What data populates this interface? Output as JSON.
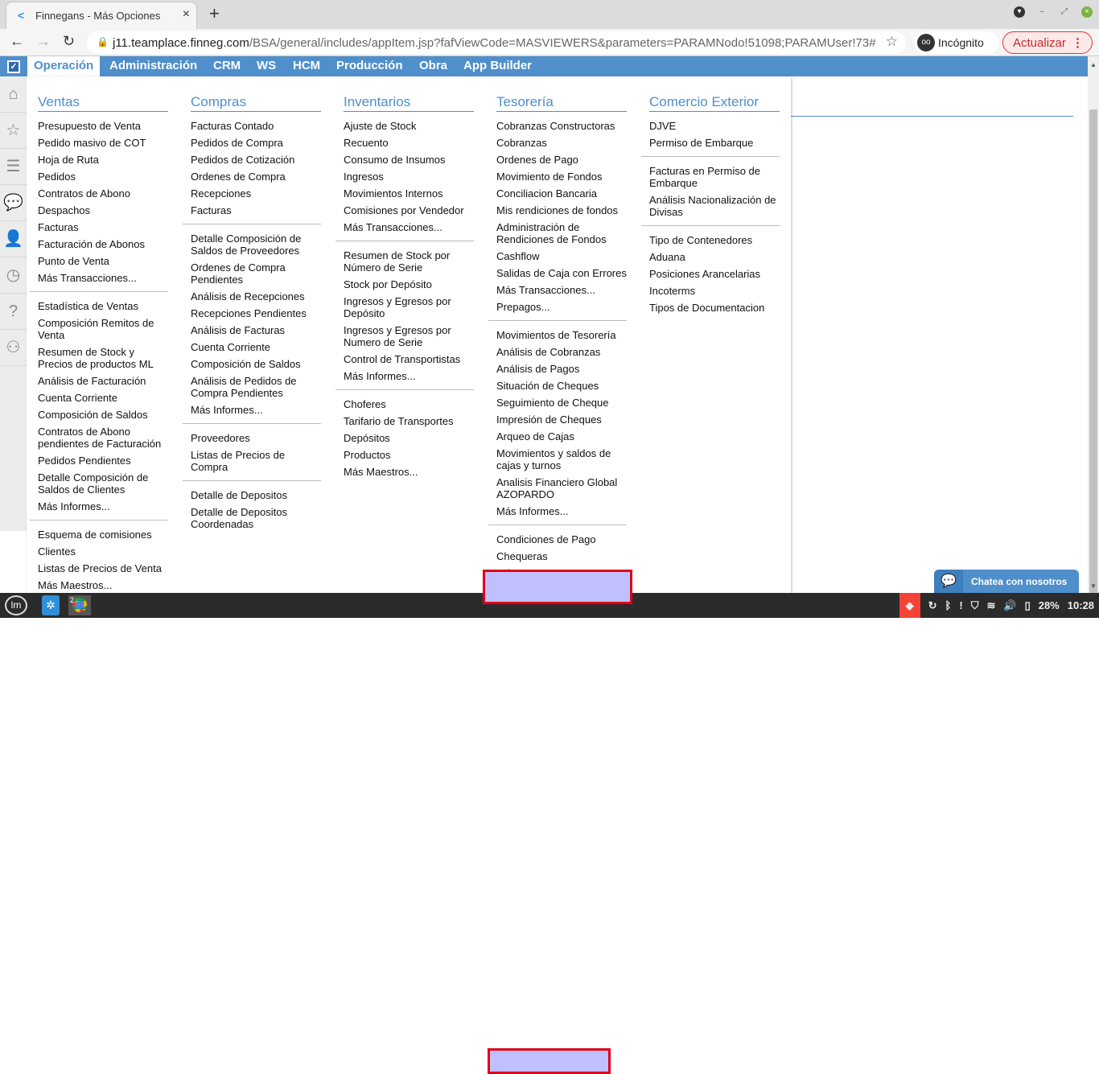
{
  "browser": {
    "tab_title": "Finnegans - Más Opciones",
    "url_host": "j11.teamplace.finneg.com",
    "url_path": "/BSA/general/includes/appItem.jsp?fafViewCode=MASVIEWERS&parameters=PARAMNodo!51098;PARAMUser!73#",
    "incognito_label": "Incógnito",
    "update_label": "Actualizar"
  },
  "menubar": {
    "items": [
      "Operación",
      "Administración",
      "CRM",
      "WS",
      "HCM",
      "Producción",
      "Obra",
      "App Builder"
    ],
    "active": "Operación"
  },
  "columns": [
    {
      "title": "Ventas",
      "groups": [
        [
          "Presupuesto de Venta",
          "Pedido masivo de COT",
          "Hoja de Ruta",
          "Pedidos",
          "Contratos de Abono",
          "Despachos",
          "Facturas",
          "Facturación de Abonos",
          "Punto de Venta",
          "Más Transacciones..."
        ],
        [
          "Estadística de Ventas",
          "Composición Remitos de Venta",
          "Resumen de Stock y Precios de productos ML",
          "Análisis de Facturación",
          "Cuenta Corriente",
          "Composición de Saldos",
          "Contratos de Abono pendientes de Facturación",
          "Pedidos Pendientes",
          "Detalle Composición de Saldos de Clientes",
          "Más Informes..."
        ],
        [
          "Esquema de comisiones",
          "Clientes",
          "Listas de Precios de Venta",
          "Más Maestros..."
        ]
      ]
    },
    {
      "title": "Compras",
      "groups": [
        [
          "Facturas Contado",
          "Pedidos de Compra",
          "Pedidos de Cotización",
          "Ordenes de Compra",
          "Recepciones",
          "Facturas"
        ],
        [
          "Detalle Composición de Saldos de Proveedores",
          "Ordenes de Compra Pendientes",
          "Análisis de Recepciones",
          "Recepciones Pendientes",
          "Análisis de Facturas",
          "Cuenta Corriente",
          "Composición de Saldos",
          "Análisis de Pedidos de Compra Pendientes",
          "Más Informes..."
        ],
        [
          "Proveedores",
          "Listas de Precios de Compra"
        ],
        [
          "Detalle de Depositos",
          "Detalle de Depositos Coordenadas"
        ]
      ]
    },
    {
      "title": "Inventarios",
      "groups": [
        [
          "Ajuste de Stock",
          "Recuento",
          "Consumo de Insumos",
          "Ingresos",
          "Movimientos Internos",
          "Comisiones por Vendedor",
          "Más Transacciones..."
        ],
        [
          "Resumen de Stock por Número de Serie",
          "Stock por Depósito",
          "Ingresos y Egresos por Depósito",
          "Ingresos y Egresos por Numero de Serie",
          "Control de Transportistas",
          "Más Informes..."
        ],
        [
          "Choferes",
          "Tarifario de Transportes",
          "Depósitos",
          "Productos",
          "Más Maestros..."
        ]
      ]
    },
    {
      "title": "Tesorería",
      "groups": [
        [
          "Cobranzas Constructoras",
          "Cobranzas",
          "Ordenes de Pago",
          "Movimiento de Fondos",
          "Conciliacion Bancaria",
          "Mis rendiciones de fondos",
          "Administración de Rendiciones de Fondos",
          "Cashflow",
          "Salidas de Caja con Errores",
          "Más Transacciones...",
          "Prepagos..."
        ],
        [
          "Movimientos de Tesorería",
          "Análisis de Cobranzas",
          "Análisis de Pagos",
          "Situación de Cheques",
          "Seguimiento de Cheque",
          "Impresión de Cheques",
          "Arqueo de Cajas",
          "Movimientos y saldos de cajas y turnos",
          "Analisis Financiero Global AZOPARDO",
          "Más Informes..."
        ],
        [
          "Condiciones de Pago",
          "Chequeras",
          "Más Maestros..."
        ]
      ]
    },
    {
      "title": "Comercio Exterior",
      "groups": [
        [
          "DJVE",
          "Permiso de Embarque"
        ],
        [
          "Facturas en Permiso de Embarque",
          "Análisis Nacionalización de Divisas"
        ],
        [
          "Tipo de Contenedores",
          "Aduana",
          "Posiciones Arancelarias",
          "Incoterms",
          "Tipos de Documentacion"
        ]
      ]
    }
  ],
  "chat": {
    "label": "Chatea con nosotros"
  },
  "taskbar": {
    "chrome_badge": "2",
    "battery": "28%",
    "clock": "10:28"
  },
  "colors": {
    "accent": "#4f8fcb",
    "highlight_bg": "#c0c0ff",
    "highlight_border": "#e0001a"
  }
}
